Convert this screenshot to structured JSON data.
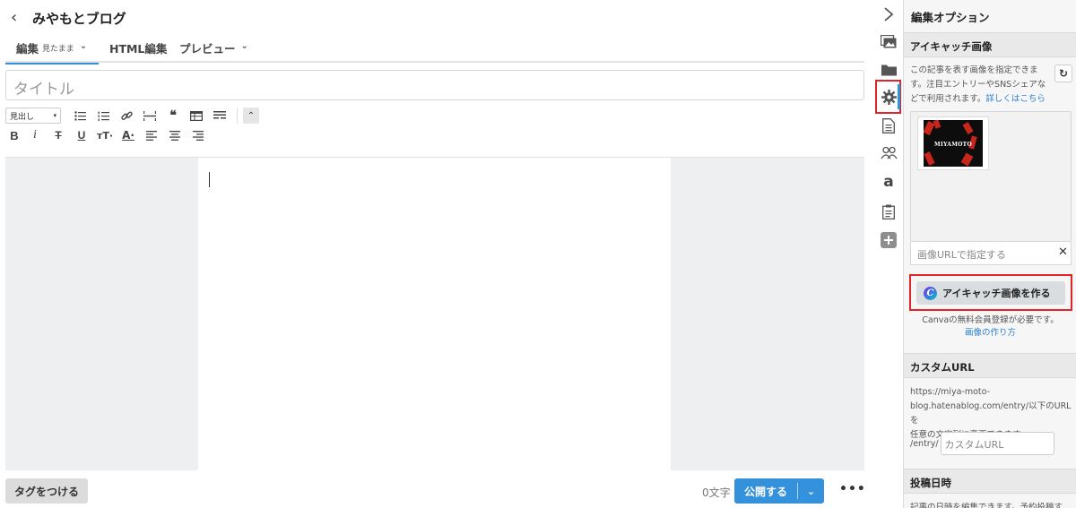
{
  "header": {
    "back_icon": "chevron-left-icon",
    "blog_name": "みやもとブログ"
  },
  "tabs": [
    {
      "label": "編集",
      "sub": "見たまま",
      "active": true
    },
    {
      "label": "HTML編集"
    },
    {
      "label": "プレビュー"
    }
  ],
  "editor": {
    "title_placeholder": "タイトル",
    "style_select": "見出し",
    "toolbar_row1": [
      "bullet-list-icon",
      "numbered-list-icon",
      "link-icon",
      "horizontal-rule-icon",
      "quote-icon",
      "table-icon",
      "more-toolbar-icon",
      "collapse-toolbar-icon"
    ],
    "toolbar_row2_labels": {
      "bold": "B",
      "italic": "i",
      "strike": "T",
      "underline": "U",
      "font_size": "тT·",
      "font_color": "A·"
    }
  },
  "bottom": {
    "tag_button": "タグをつける",
    "char_count": "0文字",
    "publish": "公開する",
    "more": "•••"
  },
  "strip": {
    "icons": [
      "collapse-panel-icon",
      "image-gallery-icon",
      "folder-icon",
      "settings-gear-icon",
      "document-icon",
      "users-icon",
      "amazon-icon",
      "clipboard-icon",
      "plus-icon"
    ],
    "active": "settings-gear-icon"
  },
  "panel": {
    "title": "編集オプション",
    "eyecatch": {
      "heading": "アイキャッチ画像",
      "desc_line1": "この記事を表す画像を指定できま",
      "desc_line2": "す。注目エントリーやSNSシェアな",
      "desc_line3": "どで利用されます。",
      "desc_link": "詳しくはこちら",
      "thumb_text": "MIYAMOTO",
      "url_placeholder": "画像URLで指定する",
      "canva_button": "アイキャッチ画像を作る",
      "canva_logo": "C",
      "note": "Canvaの無料会員登録が必要です。",
      "howto_link": "画像の作り方"
    },
    "custom_url": {
      "heading": "カスタムURL",
      "desc_line1": "https://miya-moto-",
      "desc_line2": "blog.hatenablog.com/entry/以下のURLを",
      "desc_line3": "任意の文字列に変更できます。",
      "prefix": "/entry/",
      "placeholder": "カスタムURL"
    },
    "post_date": {
      "heading": "投稿日時",
      "desc_partial": "記事の日時を編集できます。予約投稿す"
    }
  },
  "colors": {
    "accent": "#3491db",
    "highlight": "#e0242a",
    "link": "#2a7fcf"
  }
}
